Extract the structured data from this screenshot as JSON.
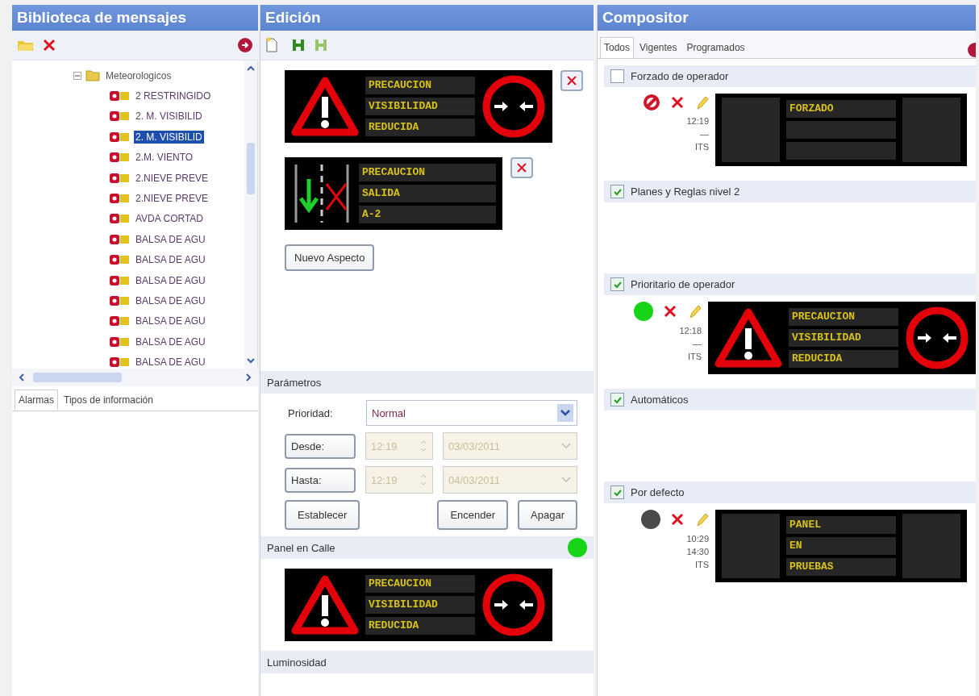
{
  "library": {
    "title": "Biblioteca de mensajes",
    "tree": [
      {
        "label": "Meteorologicos",
        "kind": "folder",
        "expanded": true,
        "children": [
          {
            "label": "2 RESTRINGIDO",
            "kind": "message",
            "selected": false
          },
          {
            "label": "2. M. VISIBILID",
            "kind": "message",
            "selected": false
          },
          {
            "label": "2. M. VISIBILID",
            "kind": "message",
            "selected": true
          },
          {
            "label": "2.M. VIENTO",
            "kind": "message",
            "selected": false
          },
          {
            "label": "2.NIEVE PREVE",
            "kind": "message",
            "selected": false
          },
          {
            "label": "2.NIEVE PREVE",
            "kind": "message",
            "selected": false
          },
          {
            "label": "AVDA CORTAD",
            "kind": "message",
            "selected": false
          },
          {
            "label": "BALSA DE AGU",
            "kind": "message",
            "selected": false
          },
          {
            "label": "BALSA DE AGU",
            "kind": "message",
            "selected": false
          },
          {
            "label": "BALSA DE AGU",
            "kind": "message",
            "selected": false
          },
          {
            "label": "BALSA DE AGU",
            "kind": "message",
            "selected": false
          },
          {
            "label": "BALSA DE AGU",
            "kind": "message",
            "selected": false
          },
          {
            "label": "BALSA DE AGU",
            "kind": "message",
            "selected": false
          },
          {
            "label": "BALSA DE AGU",
            "kind": "message",
            "selected": false
          }
        ]
      }
    ],
    "tabs": [
      {
        "label": "Alarmas",
        "selected": true
      },
      {
        "label": "Tipos de información",
        "selected": false
      }
    ]
  },
  "edition": {
    "title": "Edición",
    "aspects": [
      {
        "parts": [
          {
            "kind": "warning"
          },
          {
            "kind": "text",
            "lines": [
              "PRECAUCION",
              "VISIBILIDAD",
              "REDUCIDA"
            ]
          },
          {
            "kind": "no-overtaking"
          }
        ]
      },
      {
        "parts": [
          {
            "kind": "lanes"
          },
          {
            "kind": "text",
            "lines": [
              "PRECAUCION",
              "SALIDA",
              "A-2"
            ]
          }
        ]
      }
    ],
    "new_aspect": "Nuevo Aspecto",
    "parameters": {
      "title": "Parámetros",
      "priority": {
        "label": "Prioridad:",
        "value": "Normal"
      },
      "ranges": [
        {
          "button": "Desde:",
          "time": "12:19",
          "date": "03/03/2011",
          "disabled": true
        },
        {
          "button": "Hasta:",
          "time": "12:19",
          "date": "04/03/2011",
          "disabled": true
        }
      ],
      "actions": [
        "Establecer",
        "Encender",
        "Apagar"
      ]
    },
    "street_panel": {
      "title": "Panel en Calle",
      "on": true,
      "parts": [
        {
          "kind": "warning"
        },
        {
          "kind": "text",
          "lines": [
            "PRECAUCION",
            "VISIBILIDAD",
            "REDUCIDA"
          ]
        },
        {
          "kind": "no-overtaking"
        }
      ]
    },
    "brightness": {
      "title": "Luminosidad"
    }
  },
  "compositor": {
    "title": "Compositor",
    "tabs": [
      {
        "label": "Todos",
        "selected": true
      },
      {
        "label": "Vigentes",
        "selected": false
      },
      {
        "label": "Programados",
        "selected": false
      }
    ],
    "groups": [
      {
        "label": "Forzado de operador",
        "checked": false,
        "entries": [
          {
            "status_icon": {
              "kind": "forbidden"
            },
            "times": [
              "12:19",
              "—"
            ],
            "source": "ITS",
            "parts": [
              {
                "kind": "blank"
              },
              {
                "kind": "text",
                "lines": [
                  "FORZADO"
                ]
              },
              {
                "kind": "blank"
              }
            ]
          }
        ]
      },
      {
        "label": "Planes y Reglas nivel 2",
        "checked": true
      },
      {
        "label": "Prioritario de operador",
        "checked": true,
        "entries": [
          {
            "status_icon": {
              "kind": "on"
            },
            "times": [
              "12:18",
              "—"
            ],
            "source": "ITS",
            "parts": [
              {
                "kind": "warning"
              },
              {
                "kind": "text",
                "lines": [
                  "PRECAUCION",
                  "VISIBILIDAD",
                  "REDUCIDA"
                ]
              },
              {
                "kind": "no-overtaking"
              }
            ]
          }
        ]
      },
      {
        "label": "Automáticos",
        "checked": true
      },
      {
        "label": "Por defecto",
        "checked": true,
        "entries": [
          {
            "status_icon": {
              "kind": "off"
            },
            "times": [
              "10:29",
              "14:30"
            ],
            "source": "ITS",
            "parts": [
              {
                "kind": "blank"
              },
              {
                "kind": "text",
                "lines": [
                  "PANEL",
                  "EN",
                  "PRUEBAS"
                ]
              },
              {
                "kind": "blank"
              }
            ]
          }
        ]
      }
    ]
  }
}
